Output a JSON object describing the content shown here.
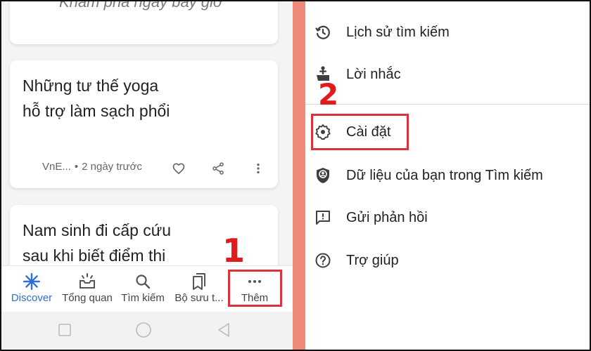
{
  "feed": {
    "cards": [
      {
        "teaser": "Khám phá ngay bây giờ"
      },
      {
        "title_line1": "Những tư thế yoga",
        "title_line2": "hỗ trợ làm sạch phổi",
        "source": "VnE...",
        "separator": "•",
        "time": "2 ngày trước",
        "actions": [
          "heart-icon",
          "share-icon",
          "more-vert-icon"
        ]
      },
      {
        "title_line1": "Nam sinh đi cấp cứu",
        "title_line2": "sau khi biết điểm thi"
      }
    ]
  },
  "bottom_nav": {
    "items": [
      {
        "label": "Discover",
        "icon": "discover-asterisk-icon",
        "active": true
      },
      {
        "label": "Tổng quan",
        "icon": "snapshot-tray-icon",
        "active": false
      },
      {
        "label": "Tìm kiếm",
        "icon": "search-icon",
        "active": false
      },
      {
        "label": "Bộ sưu t...",
        "icon": "collections-bookmark-icon",
        "active": false
      },
      {
        "label": "Thêm",
        "icon": "more-horiz-icon",
        "active": false
      }
    ]
  },
  "system_nav": [
    "recent-apps-square-icon",
    "home-circle-icon",
    "back-triangle-icon"
  ],
  "menu": {
    "items": [
      {
        "label": "Lịch sử tìm kiếm",
        "icon": "history-icon"
      },
      {
        "label": "Lời nhắc",
        "icon": "reminder-hand-icon"
      },
      {
        "label": "Cài đặt",
        "icon": "gear-icon"
      },
      {
        "label": "Dữ liệu của bạn trong Tìm kiếm",
        "icon": "shield-account-icon"
      },
      {
        "label": "Gửi phản hồi",
        "icon": "feedback-icon"
      },
      {
        "label": "Trợ giúp",
        "icon": "help-circle-icon"
      }
    ]
  },
  "annotations": {
    "step1": "1",
    "step2": "2",
    "highlight_color": "#d9343a",
    "number_color": "#e11b1b"
  },
  "colors": {
    "accent_blue": "#2f6fd6",
    "divider_strip": "#ef8a7b"
  }
}
